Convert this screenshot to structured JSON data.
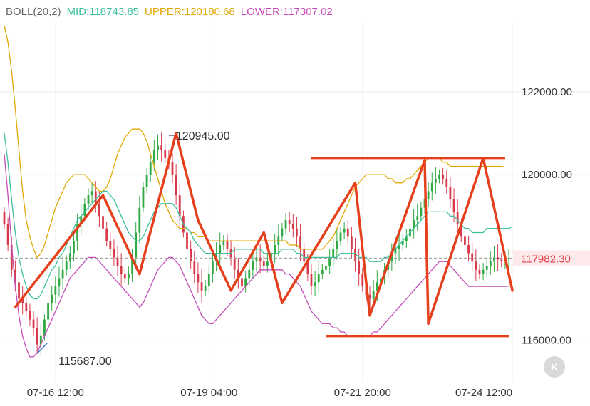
{
  "legend": {
    "name": "BOLL(20,2)",
    "mid_label": "MID:",
    "mid_value": "118743.85",
    "upper_label": "UPPER:",
    "upper_value": "120180.68",
    "lower_label": "LOWER:",
    "lower_value": "117307.02",
    "colors": {
      "name": "#666666",
      "mid": "#3cbf9d",
      "upper": "#e0a800",
      "lower": "#c44cb8"
    }
  },
  "chart_data": {
    "type": "candlestick",
    "ylim": [
      115100,
      123700
    ],
    "y_ticks": [
      "122000.00",
      "120000.00",
      "116000.00"
    ],
    "y_tick_values": [
      122000,
      120000,
      116000
    ],
    "x_ticks": [
      "07-16 12:00",
      "07-19 04:00",
      "07-21 20:00",
      "07-24 12:00"
    ],
    "x_tick_index": [
      14,
      56,
      98,
      139
    ],
    "last_price": {
      "value": 117982.3,
      "label": "117982.30"
    },
    "annotations": [
      {
        "text": "120945.00",
        "index": 45,
        "price": 120945
      },
      {
        "text": "115687.00",
        "index": 9,
        "price": 115687
      }
    ],
    "colors": {
      "up": "#2faa43",
      "down": "#d93a4a",
      "mid": "#3cbf9d",
      "upper": "#e0a800",
      "lower": "#c44cb8",
      "drawing": "#e53f1b",
      "last_price": "#e53f4a"
    },
    "closes": [
      118800,
      118300,
      117700,
      117400,
      117000,
      116900,
      116700,
      116500,
      116300,
      115900,
      116100,
      116500,
      116900,
      117100,
      117300,
      117500,
      117700,
      117900,
      118100,
      118400,
      118800,
      119000,
      119300,
      119500,
      119600,
      119300,
      119000,
      118700,
      118400,
      118200,
      118000,
      117800,
      117600,
      117500,
      117600,
      118000,
      118600,
      119200,
      119700,
      120000,
      120300,
      120600,
      120700,
      120600,
      120400,
      120300,
      120000,
      119500,
      119000,
      118600,
      118200,
      117900,
      117600,
      117400,
      117200,
      117300,
      117600,
      117900,
      118100,
      118300,
      118400,
      118200,
      118000,
      117700,
      117500,
      117300,
      117500,
      117700,
      117900,
      118000,
      117900,
      117800,
      117900,
      118100,
      118300,
      118500,
      118700,
      118900,
      118800,
      118700,
      118500,
      118200,
      117900,
      117600,
      117300,
      117400,
      117600,
      117700,
      117800,
      118000,
      118200,
      118400,
      118600,
      118700,
      118500,
      118200,
      117900,
      117600,
      117300,
      117100,
      117000,
      117200,
      117400,
      117500,
      117700,
      117900,
      118100,
      118200,
      118300,
      118400,
      118500,
      118700,
      118900,
      119000,
      119200,
      119400,
      119600,
      119800,
      119900,
      120000,
      119900,
      119700,
      119400,
      119100,
      118800,
      118500,
      118300,
      118100,
      117900,
      117700,
      117600,
      117700,
      117800,
      117900,
      118000,
      117950,
      117900,
      117950,
      117982
    ],
    "mid": [
      121000,
      120300,
      119400,
      118600,
      118000,
      117600,
      117300,
      117100,
      117000,
      117000,
      117100,
      117300,
      117500,
      117700,
      117800,
      118000,
      118100,
      118300,
      118500,
      118700,
      118900,
      119000,
      119100,
      119200,
      119300,
      119400,
      119500,
      119600,
      119600,
      119500,
      119400,
      119200,
      119000,
      118800,
      118600,
      118500,
      118400,
      118400,
      118500,
      118700,
      118900,
      119100,
      119200,
      119300,
      119300,
      119300,
      119300,
      119200,
      119000,
      118800,
      118700,
      118600,
      118400,
      118300,
      118200,
      118100,
      118100,
      118100,
      118100,
      118100,
      118100,
      118100,
      118100,
      118200,
      118200,
      118200,
      118200,
      118200,
      118200,
      118200,
      118200,
      118100,
      118100,
      118100,
      118100,
      118100,
      118200,
      118200,
      118200,
      118200,
      118100,
      118100,
      118000,
      118000,
      118000,
      118000,
      118000,
      118000,
      118000,
      118000,
      118000,
      118000,
      118100,
      118100,
      118100,
      118100,
      118100,
      118000,
      118000,
      118000,
      117900,
      117900,
      117900,
      117900,
      118000,
      118000,
      118100,
      118200,
      118300,
      118400,
      118500,
      118600,
      118700,
      118800,
      118900,
      119000,
      119100,
      119100,
      119100,
      119100,
      119100,
      119100,
      119000,
      119000,
      118900,
      118800,
      118700,
      118700,
      118600,
      118600,
      118600,
      118600,
      118700,
      118700,
      118700,
      118700,
      118700,
      118700,
      118700,
      118744
    ],
    "upper": [
      123600,
      123200,
      122500,
      121600,
      120600,
      119600,
      118900,
      118500,
      118200,
      118000,
      118100,
      118300,
      118600,
      118900,
      119200,
      119400,
      119600,
      119800,
      119900,
      120000,
      120000,
      120000,
      120000,
      119900,
      119800,
      119700,
      119600,
      119600,
      119700,
      119900,
      120200,
      120500,
      120700,
      120900,
      121000,
      121100,
      121100,
      121100,
      121000,
      120800,
      120500,
      120200,
      119900,
      119600,
      119300,
      119100,
      118900,
      118800,
      118700,
      118700,
      118700,
      118600,
      118600,
      118500,
      118500,
      118500,
      118400,
      118400,
      118400,
      118400,
      118400,
      118400,
      118400,
      118400,
      118400,
      118400,
      118400,
      118400,
      118400,
      118400,
      118400,
      118400,
      118400,
      118400,
      118400,
      118400,
      118400,
      118400,
      118300,
      118300,
      118300,
      118200,
      118200,
      118200,
      118200,
      118200,
      118200,
      118200,
      118300,
      118400,
      118500,
      118700,
      118900,
      119100,
      119300,
      119500,
      119700,
      119800,
      119900,
      120000,
      120000,
      120000,
      120000,
      120000,
      120000,
      119900,
      119900,
      119800,
      119800,
      119800,
      119900,
      119900,
      120000,
      120100,
      120200,
      120300,
      120400,
      120400,
      120400,
      120400,
      120300,
      120300,
      120200,
      120200,
      120200,
      120200,
      120200,
      120200,
      120200,
      120200,
      120200,
      120200,
      120200,
      120200,
      120200,
      120200,
      120200,
      120181
    ],
    "lower": [
      120500,
      119500,
      118300,
      117300,
      116600,
      116100,
      115800,
      115600,
      115600,
      115700,
      115900,
      116100,
      116300,
      116500,
      116700,
      116900,
      117100,
      117300,
      117500,
      117600,
      117700,
      117800,
      117900,
      118000,
      118000,
      118000,
      117900,
      117800,
      117700,
      117600,
      117500,
      117400,
      117300,
      117200,
      117100,
      117000,
      116900,
      116800,
      116900,
      117100,
      117300,
      117500,
      117700,
      117800,
      117900,
      118000,
      118000,
      117900,
      117800,
      117600,
      117400,
      117200,
      117000,
      116800,
      116600,
      116500,
      116400,
      116400,
      116500,
      116600,
      116700,
      116800,
      116900,
      117000,
      117100,
      117200,
      117300,
      117400,
      117500,
      117600,
      117700,
      117700,
      117700,
      117700,
      117700,
      117700,
      117700,
      117600,
      117600,
      117500,
      117400,
      117300,
      117100,
      116900,
      116700,
      116600,
      116500,
      116400,
      116400,
      116400,
      116300,
      116300,
      116200,
      116200,
      116100,
      116100,
      116100,
      116100,
      116100,
      116100,
      116100,
      116200,
      116200,
      116300,
      116400,
      116500,
      116600,
      116700,
      116800,
      116900,
      117000,
      117100,
      117200,
      117300,
      117400,
      117500,
      117600,
      117700,
      117800,
      117900,
      117900,
      117900,
      117800,
      117700,
      117600,
      117500,
      117400,
      117300,
      117300,
      117300,
      117300,
      117300,
      117300,
      117300,
      117300,
      117300,
      117300,
      117300,
      117307
    ]
  },
  "drawing": {
    "zigzag": [
      [
        3,
        116800
      ],
      [
        27,
        119500
      ],
      [
        37,
        117600
      ],
      [
        47,
        121000
      ],
      [
        53,
        118900
      ],
      [
        62,
        117200
      ],
      [
        71,
        118600
      ],
      [
        76,
        116900
      ],
      [
        96,
        119800
      ],
      [
        100,
        116600
      ],
      [
        115,
        120350
      ],
      [
        116,
        116400
      ],
      [
        131,
        120400
      ],
      [
        139,
        117200
      ]
    ],
    "h_lines": [
      {
        "price": 120400,
        "from": 84,
        "to": 137
      },
      {
        "price": 116100,
        "from": 88,
        "to": 138
      }
    ]
  }
}
